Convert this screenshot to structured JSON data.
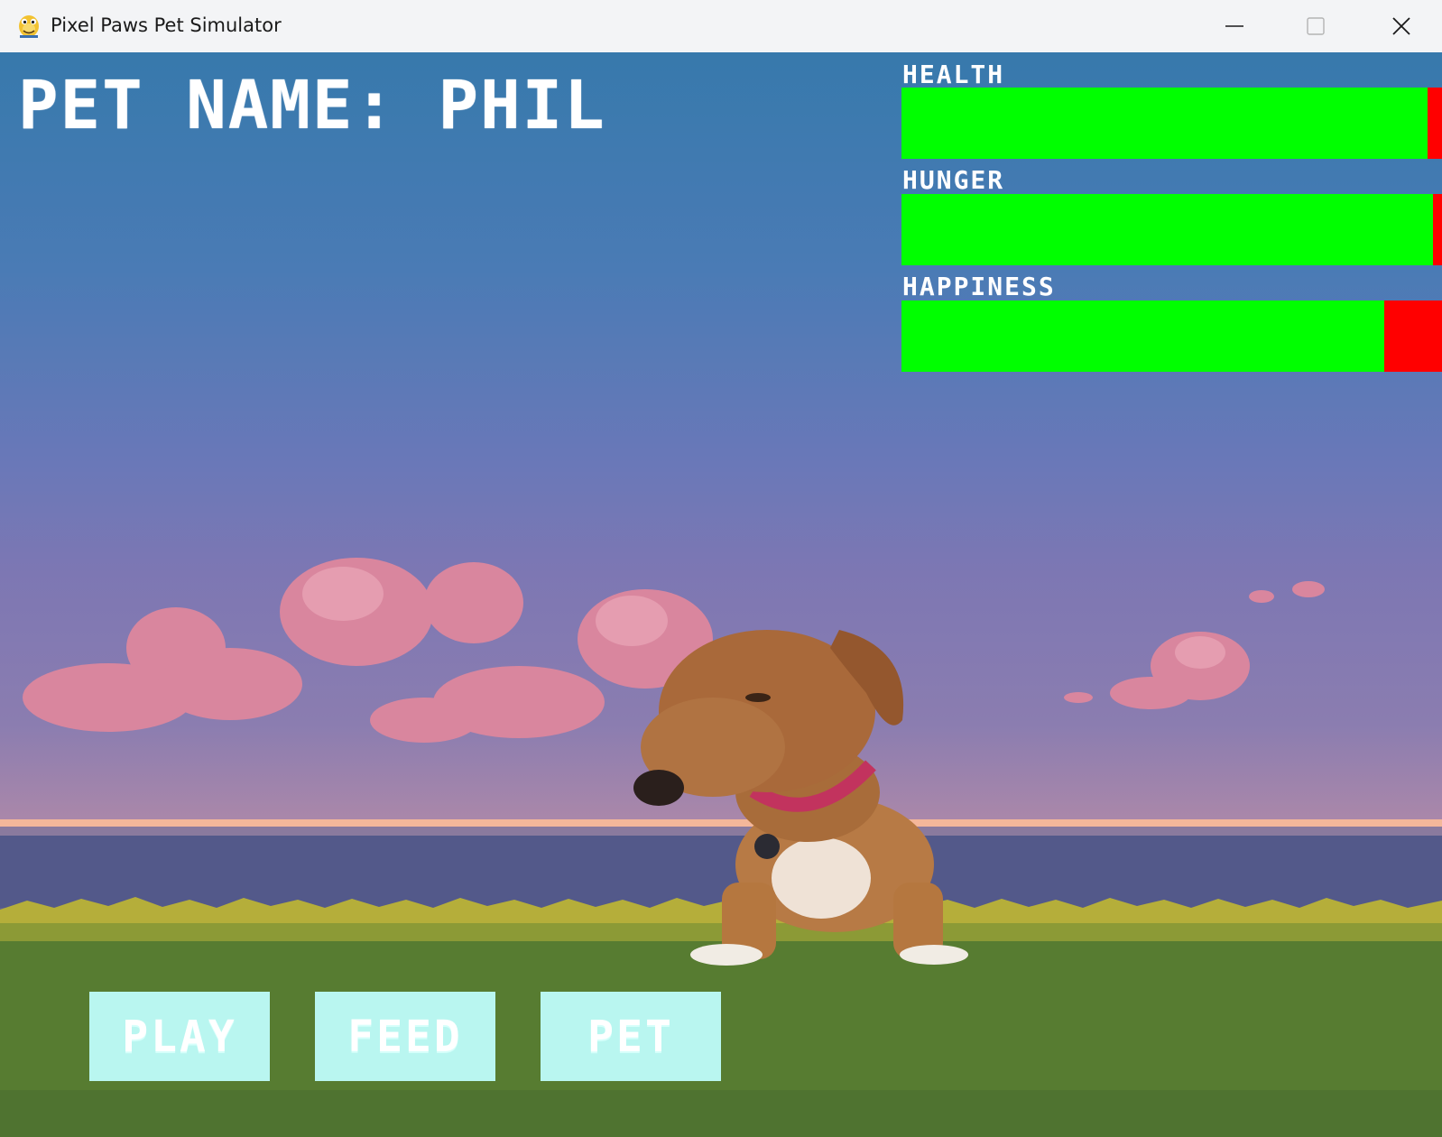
{
  "window": {
    "title": "Pixel Paws Pet Simulator",
    "app_icon": "pygame-snake-icon",
    "controls": [
      "minimize-icon",
      "maximize-icon",
      "close-icon"
    ]
  },
  "pet": {
    "name_label": "PET NAME: PHIL",
    "species": "dachshund"
  },
  "stats": [
    {
      "label": "HEALTH",
      "level": 0.974
    },
    {
      "label": "HUNGER",
      "level": 0.983
    },
    {
      "label": "HAPPINESS",
      "level": 0.893
    }
  ],
  "colors": {
    "bar_fill": "#00ff00",
    "bar_empty": "#ff0000",
    "button_bg": "#b9f6f0",
    "grass": "#577c31"
  },
  "buttons": {
    "play": "PLAY",
    "feed": "FEED",
    "pet": "PET"
  }
}
